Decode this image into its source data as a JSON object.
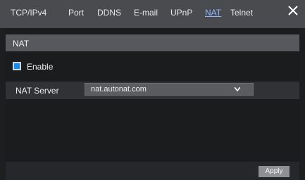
{
  "tabs": [
    {
      "label": "TCP/IPv4",
      "active": false
    },
    {
      "label": "Port",
      "active": false
    },
    {
      "label": "DDNS",
      "active": false
    },
    {
      "label": "E-mail",
      "active": false
    },
    {
      "label": "UPnP",
      "active": false
    },
    {
      "label": "NAT",
      "active": true
    },
    {
      "label": "Telnet",
      "active": false
    }
  ],
  "window": {
    "close_icon": "close-icon"
  },
  "nat": {
    "section_title": "NAT",
    "enable_label": "Enable",
    "enable_checked": true,
    "server_label": "NAT Server",
    "server_value": "nat.autonat.com"
  },
  "footer": {
    "apply_label": "Apply"
  },
  "colors": {
    "accent": "#1e88e5",
    "active_tab": "#8fb6ff"
  }
}
